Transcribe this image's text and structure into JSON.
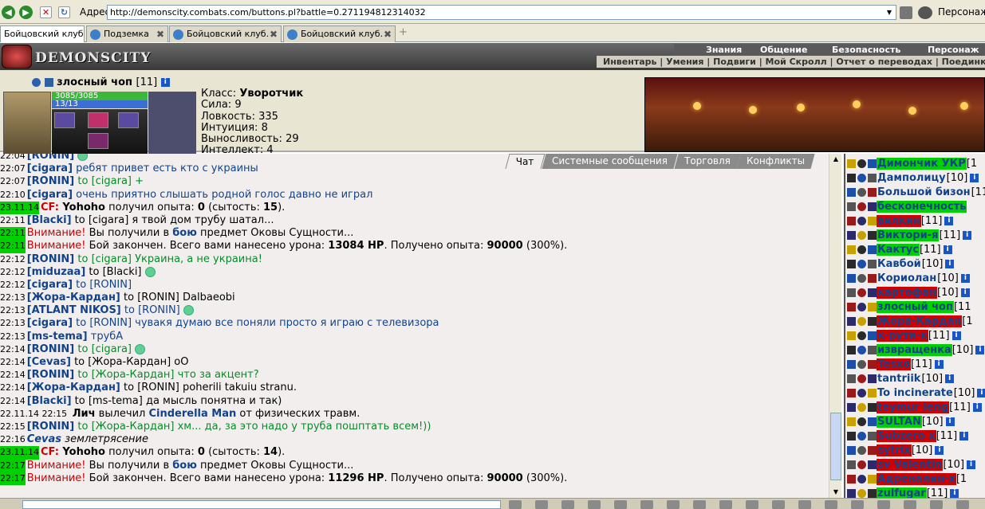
{
  "browser": {
    "address_label": "Адрес:",
    "url": "http://demonscity.combats.com/buttons.pl?battle=0.271194812314032",
    "persona_label": "Персонаж:",
    "tabs": [
      {
        "label": "Бойцовский клуб",
        "active": true
      },
      {
        "label": "Подземка"
      },
      {
        "label": "Бойцовский клуб."
      },
      {
        "label": "Бойцовский клуб."
      }
    ]
  },
  "site": {
    "logo": "DEMONSCITY",
    "top_menu": [
      "Знания",
      "Общение",
      "Безопасность",
      "Персонаж"
    ],
    "sub_menu": "Инвентарь | Умения | Подвиги | Мой Скролл | Отчет о переводах | Поединки | Анке"
  },
  "character": {
    "name": "злосный чоп",
    "level": "[11]",
    "hp": "3085/3085",
    "mp": "13/13",
    "stats": [
      {
        "label": "Класс:",
        "value": "Уворотчик",
        "bold": true
      },
      {
        "label": "Сила:",
        "value": "9"
      },
      {
        "label": "Ловкость:",
        "value": "335"
      },
      {
        "label": "Интуиция:",
        "value": "8"
      },
      {
        "label": "Выносливость:",
        "value": "29"
      },
      {
        "label": "Интеллект:",
        "value": "4"
      }
    ]
  },
  "chat": {
    "tabs": [
      "Чат",
      "Системные сообщения",
      "Торговля",
      "Конфликты"
    ],
    "lines": [
      {
        "time": "22:04",
        "parts": [
          {
            "t": "[RONIN]",
            "c": "nk"
          },
          {
            "t": " ",
            "sm": true
          }
        ]
      },
      {
        "time": "22:07",
        "parts": [
          {
            "t": "[cigara]",
            "c": "nk"
          },
          {
            "t": " ребят привет есть кто с украины"
          }
        ]
      },
      {
        "time": "22:07",
        "parts": [
          {
            "t": "[RONIN]",
            "c": "nk"
          },
          {
            "t": " to [cigara] +",
            "c": "gm"
          }
        ]
      },
      {
        "time": "22:10",
        "parts": [
          {
            "t": "[cigara]",
            "c": "nk"
          },
          {
            "t": " очень приятно слышать родной голос давно не играл"
          }
        ]
      },
      {
        "time": "23.11.14",
        "g": true,
        "parts": [
          {
            "t": "CF:",
            "c": "sys b"
          },
          {
            "t": " Yohoho",
            "c": "blk b"
          },
          {
            "t": " получил опыта: ",
            "c": "blk"
          },
          {
            "t": "0",
            "c": "blk b"
          },
          {
            "t": " (сытость: ",
            "c": "blk"
          },
          {
            "t": "15",
            "c": "blk b"
          },
          {
            "t": ").",
            "c": "blk"
          }
        ]
      },
      {
        "time": "22:11",
        "parts": [
          {
            "t": "[Blacki]",
            "c": "nk"
          },
          {
            "t": " to [cigara] я твой дом трубу шатал...",
            "c": "blk"
          }
        ]
      },
      {
        "time": "22:11",
        "g": true,
        "parts": [
          {
            "t": "Внимание!",
            "c": "sys"
          },
          {
            "t": " Вы получили в ",
            "c": "blk"
          },
          {
            "t": "бою",
            "c": "nk"
          },
          {
            "t": " предмет Оковы Сущности...",
            "c": "blk"
          }
        ]
      },
      {
        "time": "22:11",
        "g": true,
        "parts": [
          {
            "t": "Внимание!",
            "c": "sys"
          },
          {
            "t": " Бой закончен. Всего вами нанесено урона: ",
            "c": "blk"
          },
          {
            "t": "13084 HP",
            "c": "blk b"
          },
          {
            "t": ". Получено опыта: ",
            "c": "blk"
          },
          {
            "t": "90000",
            "c": "blk b"
          },
          {
            "t": " (300%).",
            "c": "blk"
          }
        ]
      },
      {
        "time": "22:12",
        "parts": [
          {
            "t": "[RONIN]",
            "c": "nk"
          },
          {
            "t": " to [cigara] Украина, а не украина!",
            "c": "gm"
          }
        ]
      },
      {
        "time": "22:12",
        "parts": [
          {
            "t": "[miduzaa]",
            "c": "nk"
          },
          {
            "t": " to [Blacki] ",
            "c": "blk"
          },
          {
            "t": " ",
            "sm": true
          }
        ]
      },
      {
        "time": "22:12",
        "parts": [
          {
            "t": "[cigara]",
            "c": "nk"
          },
          {
            "t": " to [RONIN]"
          }
        ]
      },
      {
        "time": "22:13",
        "parts": [
          {
            "t": "[Жора-Кардан]",
            "c": "nk"
          },
          {
            "t": " to [RONIN] Dalbaeobi",
            "c": "blk"
          }
        ]
      },
      {
        "time": "22:13",
        "parts": [
          {
            "t": "[ATLANT NIKOS]",
            "c": "nk"
          },
          {
            "t": " to [RONIN] "
          },
          {
            "t": " ",
            "sm": true
          }
        ]
      },
      {
        "time": "22:13",
        "parts": [
          {
            "t": "[cigara]",
            "c": "nk"
          },
          {
            "t": " to [RONIN] чувакя думаю все поняли просто я играю с телевизора"
          }
        ]
      },
      {
        "time": "22:13",
        "parts": [
          {
            "t": "[ms-tema]",
            "c": "nk"
          },
          {
            "t": " трубА"
          }
        ]
      },
      {
        "time": "22:14",
        "parts": [
          {
            "t": "[RONIN]",
            "c": "nk"
          },
          {
            "t": " to [cigara] ",
            "c": "gm"
          },
          {
            "t": " ",
            "sm": true
          }
        ]
      },
      {
        "time": "22:14",
        "parts": [
          {
            "t": "[Cevas]",
            "c": "nk"
          },
          {
            "t": " to [Жора-Кардан] оО",
            "c": "blk"
          }
        ]
      },
      {
        "time": "22:14",
        "parts": [
          {
            "t": "[RONIN]",
            "c": "nk"
          },
          {
            "t": " to [Жора-Кардан] что за акцент?",
            "c": "gm"
          }
        ]
      },
      {
        "time": "22:14",
        "parts": [
          {
            "t": "[Жора-Кардан]",
            "c": "nk"
          },
          {
            "t": " to [RONIN] poherili takuiu stranu.",
            "c": "blk"
          }
        ]
      },
      {
        "time": "22:14",
        "parts": [
          {
            "t": "[Blacki]",
            "c": "nk"
          },
          {
            "t": " to [ms-tema] да мысль понятна и так)",
            "c": "blk"
          }
        ]
      },
      {
        "time": "22.11.14 22:15",
        "parts": [
          {
            "t": " Лич",
            "c": "blk b"
          },
          {
            "t": " вылечил ",
            "c": "blk"
          },
          {
            "t": "Cinderella Man",
            "c": "nk"
          },
          {
            "t": " от физических травм.",
            "c": "blk"
          }
        ]
      },
      {
        "time": "22:15",
        "parts": [
          {
            "t": "[RONIN]",
            "c": "nk"
          },
          {
            "t": " to [Жора-Кардан] хм... да, за это надо у труба пошптать всем!))",
            "c": "gm"
          }
        ]
      },
      {
        "time": "22:16",
        "parts": [
          {
            "t": "Cevas",
            "c": "nk i"
          },
          {
            "t": " землетрясение",
            "c": "blk i"
          }
        ]
      },
      {
        "time": "23.11.14",
        "g": true,
        "parts": [
          {
            "t": "CF:",
            "c": "sys b"
          },
          {
            "t": " Yohoho",
            "c": "blk b"
          },
          {
            "t": " получил опыта: ",
            "c": "blk"
          },
          {
            "t": "0",
            "c": "blk b"
          },
          {
            "t": " (сытость: ",
            "c": "blk"
          },
          {
            "t": "14",
            "c": "blk b"
          },
          {
            "t": ").",
            "c": "blk"
          }
        ]
      },
      {
        "time": "22:17",
        "g": true,
        "parts": [
          {
            "t": "Внимание!",
            "c": "sys"
          },
          {
            "t": " Вы получили в ",
            "c": "blk"
          },
          {
            "t": "бою",
            "c": "nk"
          },
          {
            "t": " предмет Оковы Сущности...",
            "c": "blk"
          }
        ]
      },
      {
        "time": "22:17",
        "g": true,
        "parts": [
          {
            "t": "Внимание!",
            "c": "sys"
          },
          {
            "t": " Бой закончен. Всего вами нанесено урона: ",
            "c": "blk"
          },
          {
            "t": "11296 HP",
            "c": "blk b"
          },
          {
            "t": ". Получено опыта: ",
            "c": "blk"
          },
          {
            "t": "90000",
            "c": "blk b"
          },
          {
            "t": " (300%).",
            "c": "blk"
          }
        ]
      }
    ]
  },
  "users": [
    {
      "name": "Димончик УКР",
      "lvl": "[1",
      "bg": "gb"
    },
    {
      "name": "Дамполицу",
      "lvl": "[10]",
      "bg": ""
    },
    {
      "name": "Большой бизон",
      "lvl": "[11]",
      "bg": ""
    },
    {
      "name": "бесконечность",
      "lvl": "",
      "bg": "gb"
    },
    {
      "name": "вилкин",
      "lvl": "[11]",
      "bg": "rb"
    },
    {
      "name": "Виктори-я",
      "lvl": "[11]",
      "bg": "gb"
    },
    {
      "name": "Кактус",
      "lvl": "[11]",
      "bg": "gb"
    },
    {
      "name": "Кавбой",
      "lvl": "[10]",
      "bg": ""
    },
    {
      "name": "Кориолан",
      "lvl": "[10]",
      "bg": ""
    },
    {
      "name": "картофан",
      "lvl": "[10]",
      "bg": "rb"
    },
    {
      "name": "злосный чоп",
      "lvl": "[11",
      "bg": "gb"
    },
    {
      "name": "Жора-Кардан",
      "lvl": "[1",
      "bg": "rb"
    },
    {
      "name": "к-рути-к",
      "lvl": "[11]",
      "bg": "rb"
    },
    {
      "name": "извращенка",
      "lvl": "[10]",
      "bg": "gb"
    },
    {
      "name": "Tesxo",
      "lvl": "[11]",
      "bg": "rb"
    },
    {
      "name": "tantriik",
      "lvl": "[10]",
      "bg": ""
    },
    {
      "name": "To incinerate",
      "lvl": "[10]",
      "bg": ""
    },
    {
      "name": "teymur leng",
      "lvl": "[11]",
      "bg": "rb"
    },
    {
      "name": "SULTAN",
      "lvl": "[10]",
      "bg": "gb"
    },
    {
      "name": "Subzero x",
      "lvl": "[11]",
      "bg": "rb"
    },
    {
      "name": "sytrix",
      "lvl": "[10]",
      "bg": "rb"
    },
    {
      "name": "sv Valentin",
      "lvl": "[10]",
      "bg": "rb"
    },
    {
      "name": "Адреналин-х",
      "lvl": "[1",
      "bg": "rb"
    },
    {
      "name": "zulfugar",
      "lvl": "[11]",
      "bg": "gb"
    }
  ]
}
